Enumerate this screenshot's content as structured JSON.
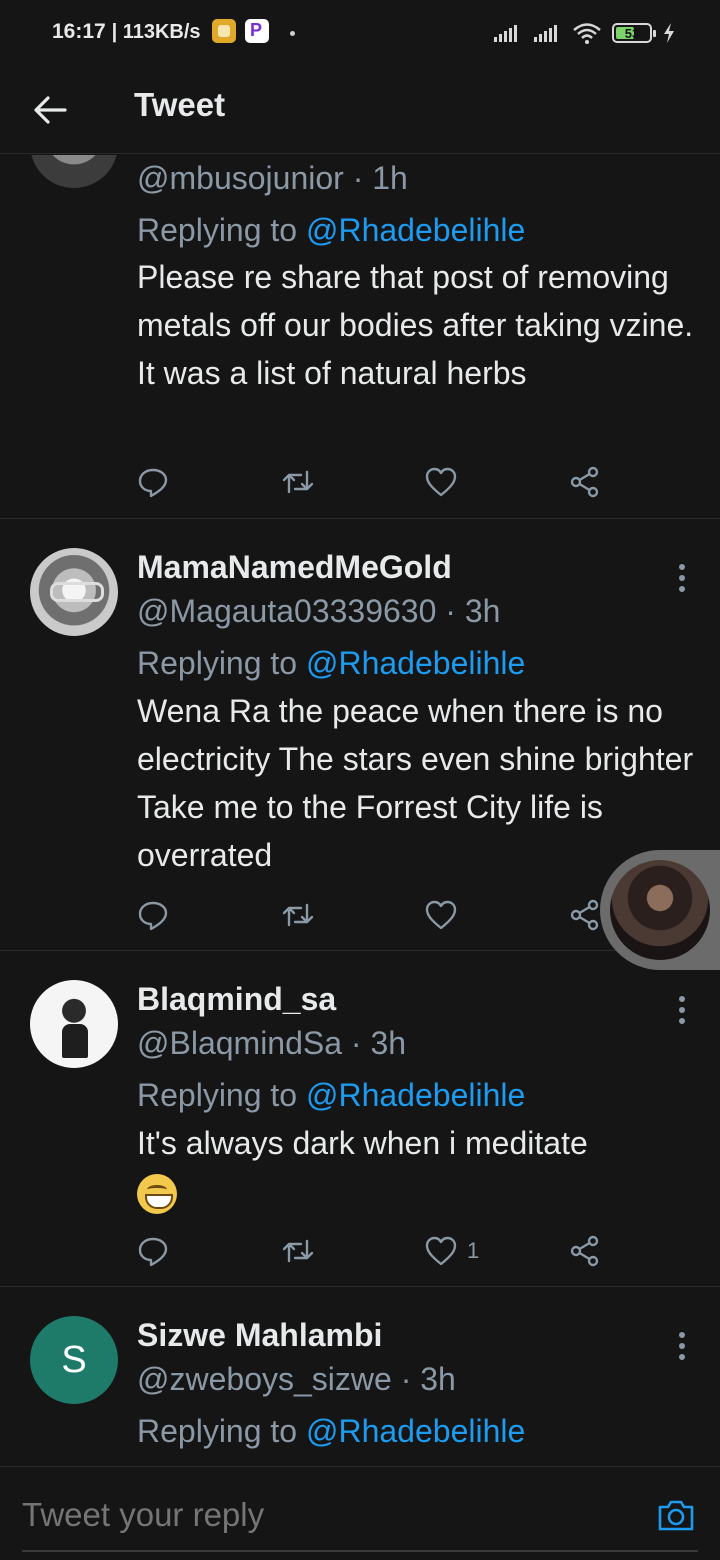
{
  "status_bar": {
    "time": "16:17",
    "net_speed": "| 113KB/s",
    "battery": "53"
  },
  "header": {
    "title": "Tweet"
  },
  "tweets": [
    {
      "handle": "@mbusojunior · 1h",
      "replying_prefix": "Replying to ",
      "replying_to": "@Rhadebelihle",
      "text": "Please re share that post of removing metals off our bodies after taking vzine. It was a list of natural herbs",
      "likes": ""
    },
    {
      "name": "MamaNamedMeGold",
      "handle": "@Magauta03339630 · 3h",
      "replying_prefix": "Replying to ",
      "replying_to": "@Rhadebelihle",
      "text": "Wena Ra the peace when there is no electricity The stars even shine brighter Take me to the Forrest City life is overrated",
      "likes": ""
    },
    {
      "name": "Blaqmind_sa",
      "handle": "@BlaqmindSa · 3h",
      "replying_prefix": "Replying to ",
      "replying_to": "@Rhadebelihle",
      "text": "It's always dark when i meditate",
      "likes": "1"
    },
    {
      "name": "Sizwe Mahlambi",
      "avatar_letter": "S",
      "handle": "@zweboys_sizwe · 3h",
      "replying_prefix": "Replying to ",
      "replying_to": "@Rhadebelihle"
    }
  ],
  "reply_bar": {
    "placeholder": "Tweet your reply"
  },
  "colors": {
    "background": "#151515",
    "mention": "#1d9bf0",
    "secondary_text": "#8b98a5",
    "primary_text": "#e7e9ea"
  }
}
